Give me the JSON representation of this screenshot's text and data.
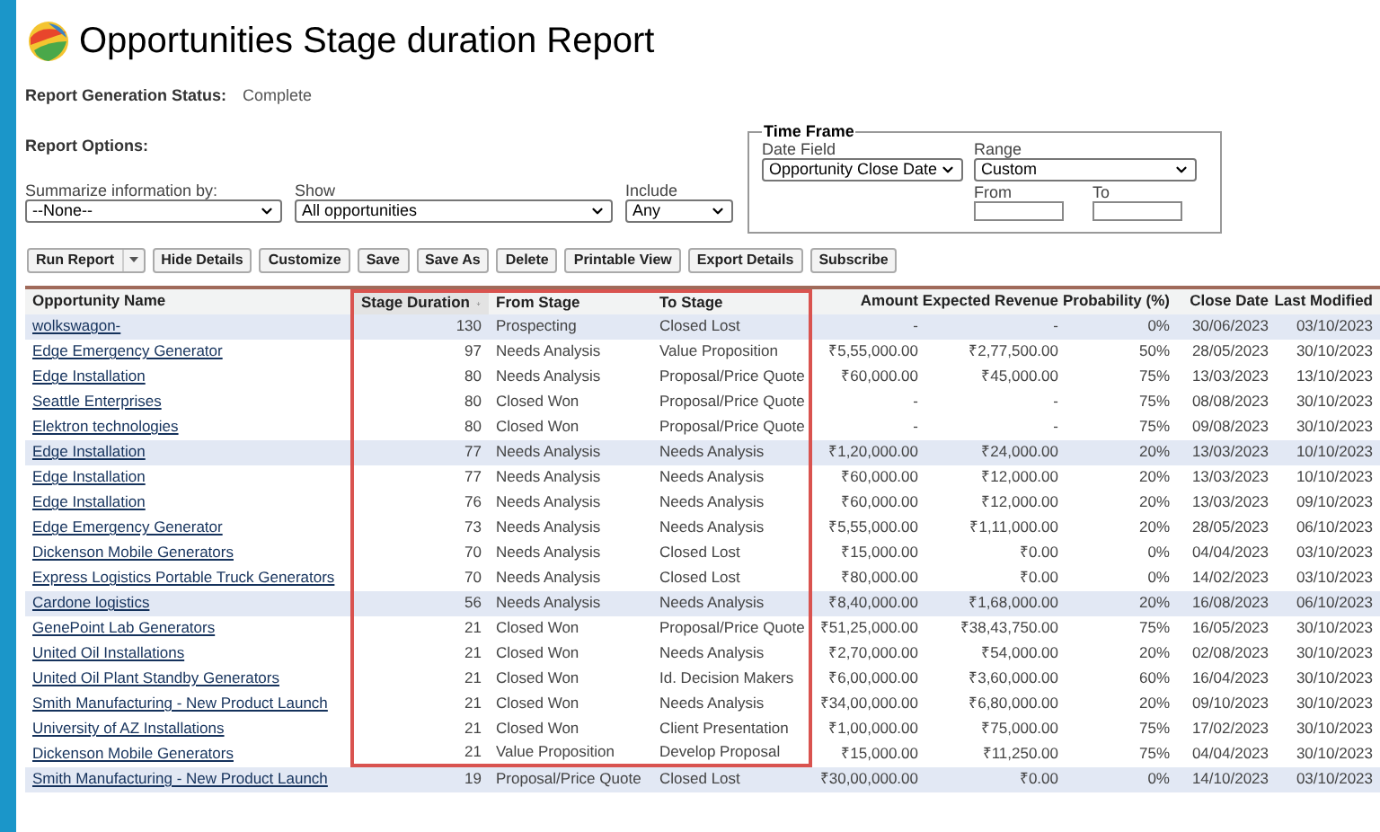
{
  "title": "Opportunities Stage duration Report",
  "status": {
    "label": "Report Generation Status:",
    "value": "Complete"
  },
  "options_label": "Report Options:",
  "filters": [
    {
      "label": "Summarize information by:",
      "value": "--None--"
    },
    {
      "label": "Show",
      "value": "All opportunities"
    },
    {
      "label": "Include",
      "value": "Any"
    }
  ],
  "time_frame": {
    "legend": "Time Frame",
    "date_field": {
      "label": "Date Field",
      "value": "Opportunity Close Date"
    },
    "range": {
      "label": "Range",
      "value": "Custom"
    },
    "from": {
      "label": "From"
    },
    "to": {
      "label": "To"
    }
  },
  "buttons": [
    {
      "label": "Run Report",
      "kind": "split"
    },
    {
      "label": "Hide Details",
      "kind": "plain"
    },
    {
      "label": "Customize",
      "kind": "plain"
    },
    {
      "label": "Save",
      "kind": "plain"
    },
    {
      "label": "Save As",
      "kind": "plain"
    },
    {
      "label": "Delete",
      "kind": "plain"
    },
    {
      "label": "Printable View",
      "kind": "plain"
    },
    {
      "label": "Export Details",
      "kind": "plain"
    },
    {
      "label": "Subscribe",
      "kind": "plain"
    }
  ],
  "table": {
    "columns": [
      {
        "label": "Opportunity Name",
        "kind": "link",
        "sorted": false,
        "highlighted": false
      },
      {
        "label": "Stage Duration",
        "kind": "number",
        "sorted": true,
        "highlighted": true
      },
      {
        "label": "From Stage",
        "kind": "text",
        "sorted": false,
        "highlighted": true
      },
      {
        "label": "To Stage",
        "kind": "text",
        "sorted": false,
        "highlighted": true
      },
      {
        "label": "Amount",
        "kind": "number",
        "sorted": false,
        "highlighted": false
      },
      {
        "label": "Expected Revenue",
        "kind": "number",
        "sorted": false,
        "highlighted": false
      },
      {
        "label": "Probability (%)",
        "kind": "number",
        "sorted": false,
        "highlighted": false
      },
      {
        "label": "Close Date",
        "kind": "number",
        "sorted": false,
        "highlighted": false
      },
      {
        "label": "Last Modified",
        "kind": "number",
        "sorted": false,
        "highlighted": false
      }
    ],
    "rows": [
      {
        "shaded": true,
        "highlighted": true,
        "cells": [
          "wolkswagon-",
          "130",
          "Prospecting",
          "Closed Lost",
          "-",
          "-",
          "0%",
          "30/06/2023",
          "03/10/2023"
        ]
      },
      {
        "shaded": false,
        "highlighted": true,
        "cells": [
          "Edge Emergency Generator",
          "97",
          "Needs Analysis",
          "Value Proposition",
          "₹5,55,000.00",
          "₹2,77,500.00",
          "50%",
          "28/05/2023",
          "30/10/2023"
        ]
      },
      {
        "shaded": false,
        "highlighted": true,
        "cells": [
          "Edge Installation",
          "80",
          "Needs Analysis",
          "Proposal/Price Quote",
          "₹60,000.00",
          "₹45,000.00",
          "75%",
          "13/03/2023",
          "13/10/2023"
        ]
      },
      {
        "shaded": false,
        "highlighted": true,
        "cells": [
          "Seattle Enterprises",
          "80",
          "Closed Won",
          "Proposal/Price Quote",
          "-",
          "-",
          "75%",
          "08/08/2023",
          "30/10/2023"
        ]
      },
      {
        "shaded": false,
        "highlighted": true,
        "cells": [
          "Elektron technologies",
          "80",
          "Closed Won",
          "Proposal/Price Quote",
          "-",
          "-",
          "75%",
          "09/08/2023",
          "30/10/2023"
        ]
      },
      {
        "shaded": true,
        "highlighted": true,
        "cells": [
          "Edge Installation",
          "77",
          "Needs Analysis",
          "Needs Analysis",
          "₹1,20,000.00",
          "₹24,000.00",
          "20%",
          "13/03/2023",
          "10/10/2023"
        ]
      },
      {
        "shaded": false,
        "highlighted": true,
        "cells": [
          "Edge Installation",
          "77",
          "Needs Analysis",
          "Needs Analysis",
          "₹60,000.00",
          "₹12,000.00",
          "20%",
          "13/03/2023",
          "10/10/2023"
        ]
      },
      {
        "shaded": false,
        "highlighted": true,
        "cells": [
          "Edge Installation",
          "76",
          "Needs Analysis",
          "Needs Analysis",
          "₹60,000.00",
          "₹12,000.00",
          "20%",
          "13/03/2023",
          "09/10/2023"
        ]
      },
      {
        "shaded": false,
        "highlighted": true,
        "cells": [
          "Edge Emergency Generator",
          "73",
          "Needs Analysis",
          "Needs Analysis",
          "₹5,55,000.00",
          "₹1,11,000.00",
          "20%",
          "28/05/2023",
          "06/10/2023"
        ]
      },
      {
        "shaded": false,
        "highlighted": true,
        "cells": [
          "Dickenson Mobile Generators",
          "70",
          "Needs Analysis",
          "Closed Lost",
          "₹15,000.00",
          "₹0.00",
          "0%",
          "04/04/2023",
          "03/10/2023"
        ]
      },
      {
        "shaded": false,
        "highlighted": true,
        "cells": [
          "Express Logistics Portable Truck Generators",
          "70",
          "Needs Analysis",
          "Closed Lost",
          "₹80,000.00",
          "₹0.00",
          "0%",
          "14/02/2023",
          "03/10/2023"
        ]
      },
      {
        "shaded": true,
        "highlighted": true,
        "cells": [
          "Cardone logistics",
          "56",
          "Needs Analysis",
          "Needs Analysis",
          "₹8,40,000.00",
          "₹1,68,000.00",
          "20%",
          "16/08/2023",
          "06/10/2023"
        ]
      },
      {
        "shaded": false,
        "highlighted": true,
        "cells": [
          "GenePoint Lab Generators",
          "21",
          "Closed Won",
          "Proposal/Price Quote",
          "₹51,25,000.00",
          "₹38,43,750.00",
          "75%",
          "16/05/2023",
          "30/10/2023"
        ]
      },
      {
        "shaded": false,
        "highlighted": true,
        "cells": [
          "United Oil Installations",
          "21",
          "Closed Won",
          "Needs Analysis",
          "₹2,70,000.00",
          "₹54,000.00",
          "20%",
          "02/08/2023",
          "30/10/2023"
        ]
      },
      {
        "shaded": false,
        "highlighted": true,
        "cells": [
          "United Oil Plant Standby Generators",
          "21",
          "Closed Won",
          "Id. Decision Makers",
          "₹6,00,000.00",
          "₹3,60,000.00",
          "60%",
          "16/04/2023",
          "30/10/2023"
        ]
      },
      {
        "shaded": false,
        "highlighted": true,
        "cells": [
          "Smith Manufacturing - New Product Launch",
          "21",
          "Closed Won",
          "Needs Analysis",
          "₹34,00,000.00",
          "₹6,80,000.00",
          "20%",
          "09/10/2023",
          "30/10/2023"
        ]
      },
      {
        "shaded": false,
        "highlighted": true,
        "cells": [
          "University of AZ Installations",
          "21",
          "Closed Won",
          "Client Presentation",
          "₹1,00,000.00",
          "₹75,000.00",
          "75%",
          "17/02/2023",
          "30/10/2023"
        ]
      },
      {
        "shaded": false,
        "highlighted": true,
        "cells": [
          "Dickenson Mobile Generators",
          "21",
          "Value Proposition",
          "Develop Proposal",
          "₹15,000.00",
          "₹11,250.00",
          "75%",
          "04/04/2023",
          "30/10/2023"
        ]
      },
      {
        "shaded": true,
        "highlighted": false,
        "cells": [
          "Smith Manufacturing - New Product Launch",
          "19",
          "Proposal/Price Quote",
          "Closed Lost",
          "₹30,00,000.00",
          "₹0.00",
          "0%",
          "14/10/2023",
          "03/10/2023"
        ]
      }
    ]
  }
}
